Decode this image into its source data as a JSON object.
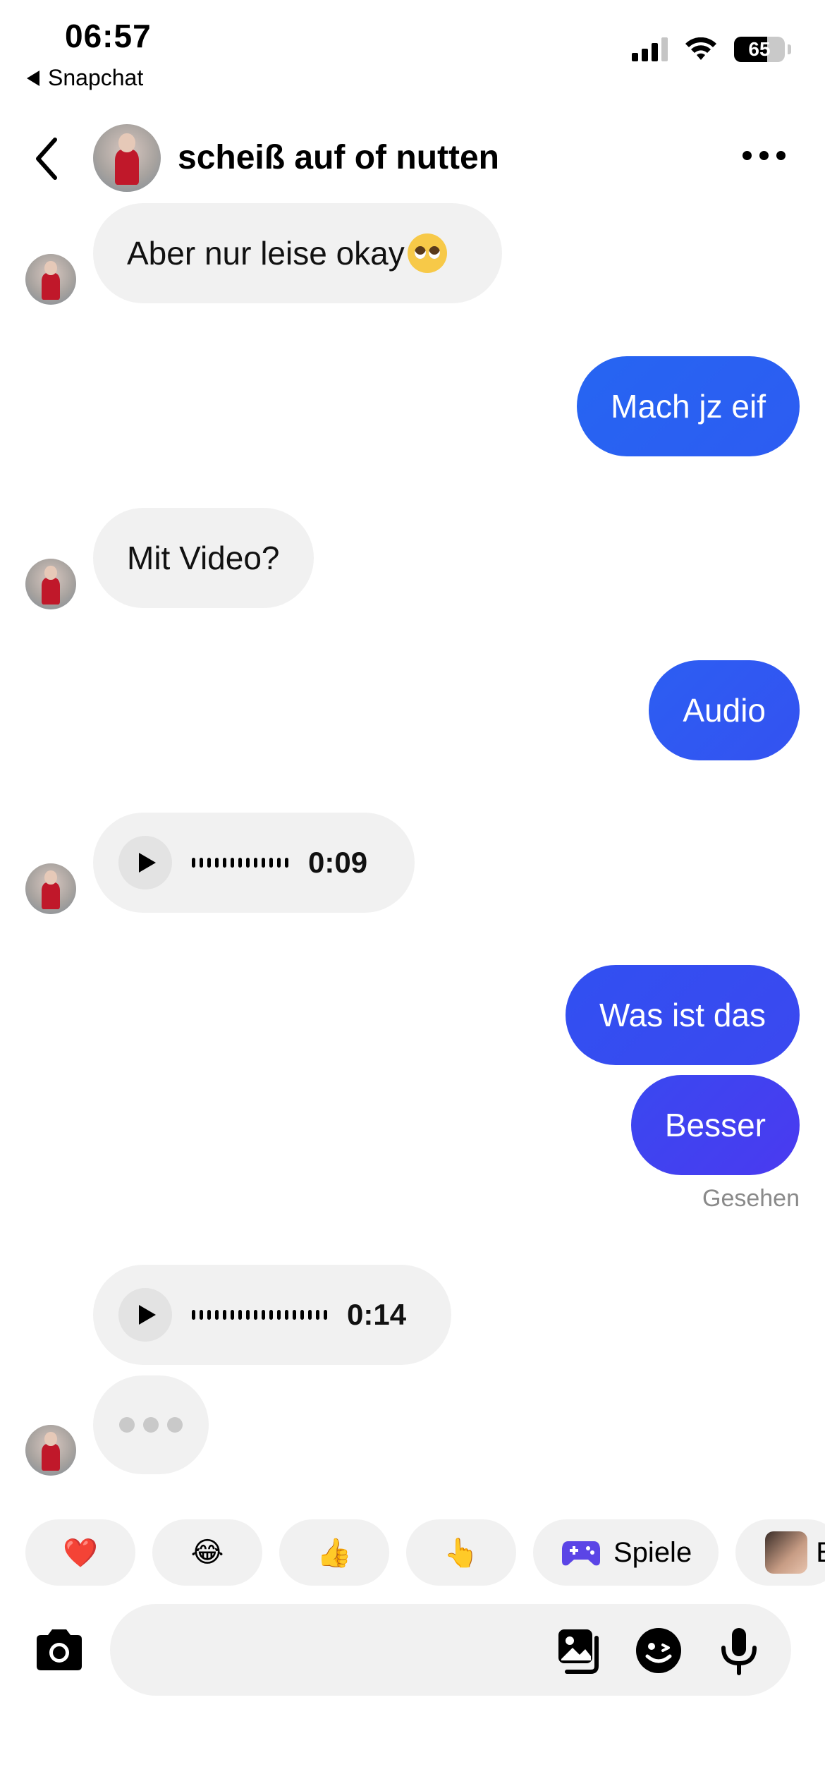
{
  "status_bar": {
    "time": "06:57",
    "back_app": "Snapchat",
    "battery": "65",
    "battery_level": 0.65
  },
  "header": {
    "title": "scheiß auf of nutten"
  },
  "messages": [
    {
      "side": "in",
      "type": "text",
      "text": "Aber nur leise okay"
    },
    {
      "side": "out",
      "type": "text",
      "text": "Mach jz eif"
    },
    {
      "side": "in",
      "type": "text",
      "text": "Mit Video?"
    },
    {
      "side": "out",
      "type": "text",
      "text": "Audio"
    },
    {
      "side": "in",
      "type": "audio",
      "duration": "0:09"
    },
    {
      "side": "out",
      "type": "text",
      "text": "Was ist das"
    },
    {
      "side": "out",
      "type": "text",
      "text": "Besser"
    },
    {
      "side": "in",
      "type": "audio",
      "duration": "0:14"
    }
  ],
  "seen_label": "Gesehen",
  "quick_reactions": {
    "emojis": [
      "❤️",
      "😂",
      "👍",
      "👆"
    ],
    "games_label": "Spiele",
    "extra_label": "E"
  },
  "colors": {
    "outgoing_bubble_start": "#2563f2",
    "outgoing_bubble_end": "#4a3af0",
    "incoming_bubble": "#f1f1f1"
  }
}
